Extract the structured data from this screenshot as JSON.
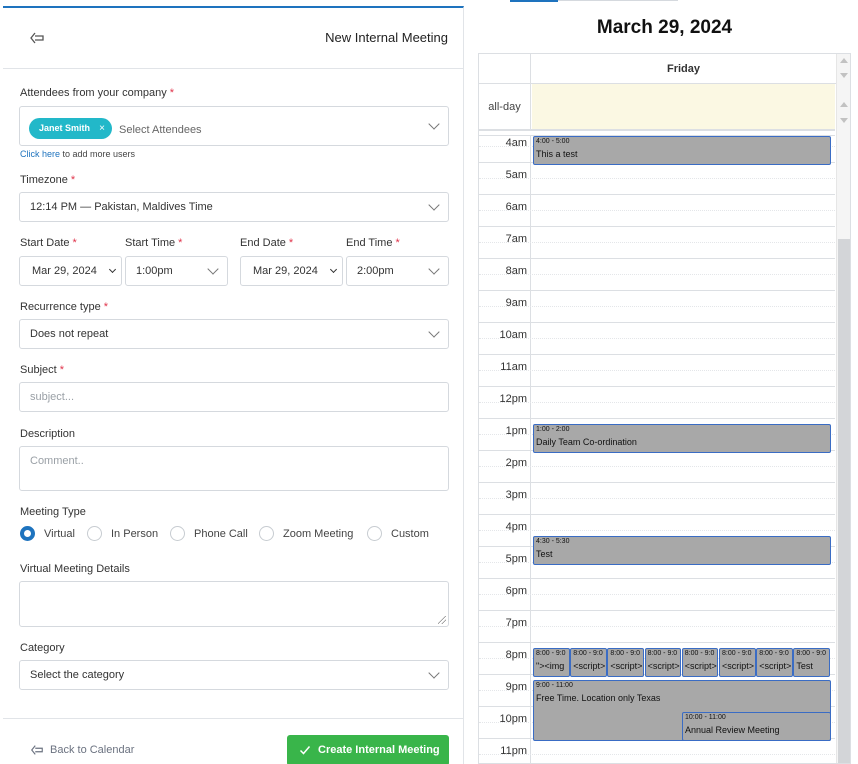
{
  "form": {
    "title": "New Internal Meeting",
    "attendees": {
      "label": "Attendees from your company",
      "chip": "Janet Smith",
      "chip_remove": "×",
      "placeholder": "Select Attendees"
    },
    "hint": {
      "link": "Click here",
      "text": " to add more users"
    },
    "timezone": {
      "label": "Timezone",
      "value": "12:14 PM — Pakistan, Maldives Time"
    },
    "start_date": {
      "label": "Start Date",
      "value": "Mar 29, 2024"
    },
    "start_time": {
      "label": "Start Time",
      "value": "1:00pm"
    },
    "end_date": {
      "label": "End Date",
      "value": "Mar 29, 2024"
    },
    "end_time": {
      "label": "End Time",
      "value": "2:00pm"
    },
    "recurrence": {
      "label": "Recurrence type",
      "value": "Does not repeat"
    },
    "subject": {
      "label": "Subject",
      "placeholder": "subject..."
    },
    "description": {
      "label": "Description",
      "placeholder": "Comment.."
    },
    "meeting_type": {
      "label": "Meeting Type",
      "options": [
        "Virtual",
        "In Person",
        "Phone Call",
        "Zoom Meeting",
        "Custom"
      ],
      "selected": "Virtual"
    },
    "virtual_details": {
      "label": "Virtual Meeting Details"
    },
    "category": {
      "label": "Category",
      "placeholder": "Select the category"
    },
    "required_mark": "*",
    "back_label": "Back to Calendar",
    "create_label": "Create Internal Meeting"
  },
  "calendar": {
    "date": "March 29, 2024",
    "day": "Friday",
    "all_day": "all-day",
    "hours": [
      "4am",
      "5am",
      "6am",
      "7am",
      "8am",
      "9am",
      "10am",
      "11am",
      "12pm",
      "1pm",
      "2pm",
      "3pm",
      "4pm",
      "5pm",
      "6pm",
      "7pm",
      "8pm",
      "9pm",
      "10pm",
      "11pm"
    ],
    "events": [
      {
        "time": "4:00 - 5:00",
        "title": "This a test"
      },
      {
        "time": "1:00 - 2:00",
        "title": "Daily Team Co-ordination"
      },
      {
        "time": "4:30 - 5:30",
        "title": "Test"
      },
      {
        "time": "8:00 - 9:0",
        "title": "\"><img"
      },
      {
        "time": "8:00 - 9:0",
        "title": "<script>"
      },
      {
        "time": "8:00 - 9:0",
        "title": "<script>"
      },
      {
        "time": "8:00 - 9:0",
        "title": "<script>"
      },
      {
        "time": "8:00 - 9:0",
        "title": "<script>"
      },
      {
        "time": "8:00 - 9:0",
        "title": "<script>"
      },
      {
        "time": "8:00 - 9:0",
        "title": "<script>"
      },
      {
        "time": "8:00 - 9:0",
        "title": "Test"
      },
      {
        "time": "9:00 - 11:00",
        "title": "Free Time. Location only Texas"
      },
      {
        "time": "10:00 - 11:00",
        "title": "Annual Review Meeting"
      }
    ]
  },
  "colors": {
    "accent": "#1e73be",
    "chip": "#22b8c9",
    "create_button": "#39b54a",
    "event_fill": "#a8a8a8",
    "event_border": "#3a6cc4",
    "allday_bg": "#fbf8e3",
    "required": "#e0334a"
  }
}
